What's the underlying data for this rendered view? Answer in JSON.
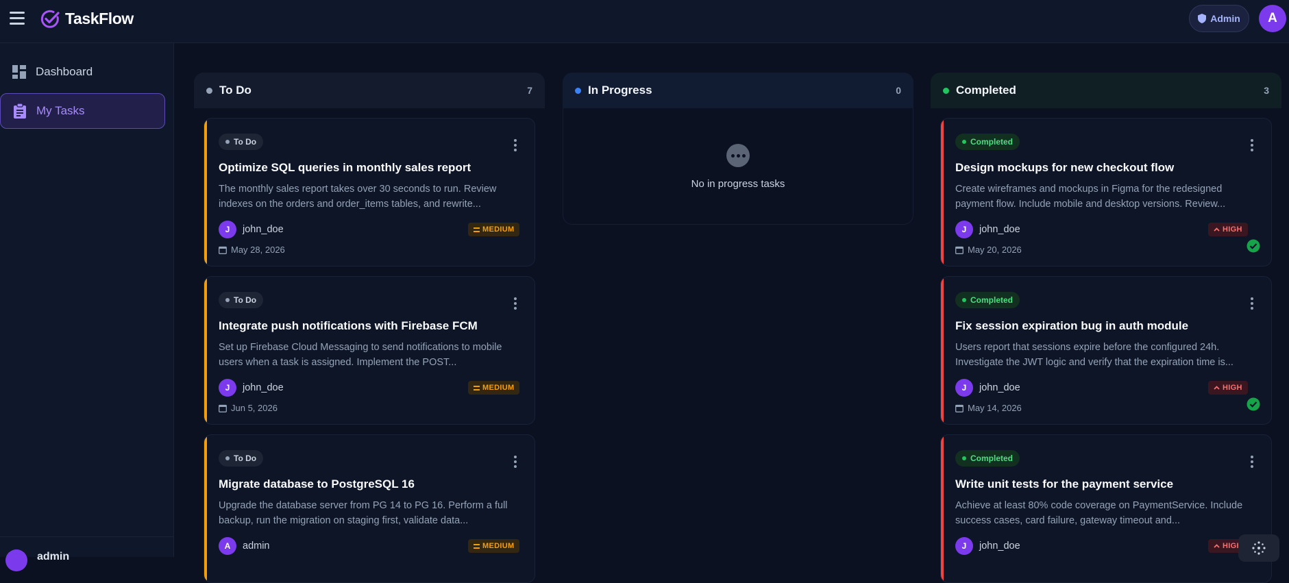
{
  "app": {
    "brand": "TaskFlow",
    "role_badge": "Admin",
    "user_initial": "A",
    "accent": "#7c3aed"
  },
  "sidebar": {
    "items": [
      {
        "label": "Dashboard",
        "icon": "dashboard-icon",
        "active": false
      },
      {
        "label": "My Tasks",
        "icon": "clipboard-icon",
        "active": true
      }
    ],
    "footer_user": "admin"
  },
  "columns": [
    {
      "title": "To Do",
      "count": "7",
      "dot": "#94a3b8",
      "cards": [
        {
          "status": "To Do",
          "title": "Optimize SQL queries in monthly sales report",
          "desc": "The monthly sales report takes over 30 seconds to run. Review indexes on the orders and order_items tables, and rewrite...",
          "assignee": "john_doe",
          "initial": "J",
          "priority": "MEDIUM",
          "due": "May 28, 2026"
        },
        {
          "status": "To Do",
          "title": "Integrate push notifications with Firebase FCM",
          "desc": "Set up Firebase Cloud Messaging to send notifications to mobile users when a task is assigned. Implement the POST...",
          "assignee": "john_doe",
          "initial": "J",
          "priority": "MEDIUM",
          "due": "Jun 5, 2026"
        },
        {
          "status": "To Do",
          "title": "Migrate database to PostgreSQL 16",
          "desc": "Upgrade the database server from PG 14 to PG 16. Perform a full backup, run the migration on staging first, validate data...",
          "assignee": "admin",
          "initial": "A",
          "priority": "MEDIUM",
          "due": ""
        }
      ]
    },
    {
      "title": "In Progress",
      "count": "0",
      "dot": "#3b82f6",
      "empty_text": "No in progress tasks"
    },
    {
      "title": "Completed",
      "count": "3",
      "dot": "#22c55e",
      "cards": [
        {
          "status": "Completed",
          "title": "Design mockups for new checkout flow",
          "desc": "Create wireframes and mockups in Figma for the redesigned payment flow. Include mobile and desktop versions. Review...",
          "assignee": "john_doe",
          "initial": "J",
          "priority": "HIGH",
          "due": "May 20, 2026"
        },
        {
          "status": "Completed",
          "title": "Fix session expiration bug in auth module",
          "desc": "Users report that sessions expire before the configured 24h. Investigate the JWT logic and verify that the expiration time is...",
          "assignee": "john_doe",
          "initial": "J",
          "priority": "HIGH",
          "due": "May 14, 2026"
        },
        {
          "status": "Completed",
          "title": "Write unit tests for the payment service",
          "desc": "Achieve at least 80% code coverage on PaymentService. Include success cases, card failure, gateway timeout and...",
          "assignee": "john_doe",
          "initial": "J",
          "priority": "HIGH",
          "due": ""
        }
      ]
    }
  ]
}
